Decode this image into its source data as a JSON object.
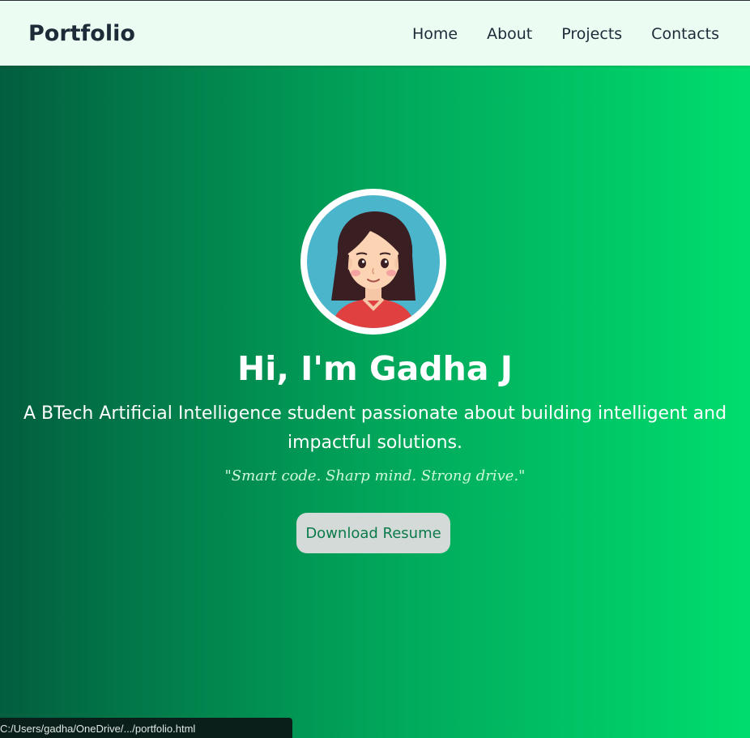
{
  "navbar": {
    "brand": "Portfolio",
    "links": [
      "Home",
      "About",
      "Projects",
      "Contacts"
    ]
  },
  "hero": {
    "avatar_icon": "girl-avatar-icon",
    "title": "Hi, I'm Gadha J",
    "subtitle": "A BTech Artificial Intelligence student passionate about building intelligent and impactful solutions.",
    "quote": "\"Smart code. Sharp mind. Strong drive.\"",
    "button_label": "Download Resume"
  },
  "status_bar": {
    "url": "C:/Users/gadha/OneDrive/.../portfolio.html"
  },
  "colors": {
    "nav_bg": "#ebfdf3",
    "gradient_start": "#025e3f",
    "gradient_end": "#00dd6e",
    "button_text": "#0a7a4a"
  }
}
